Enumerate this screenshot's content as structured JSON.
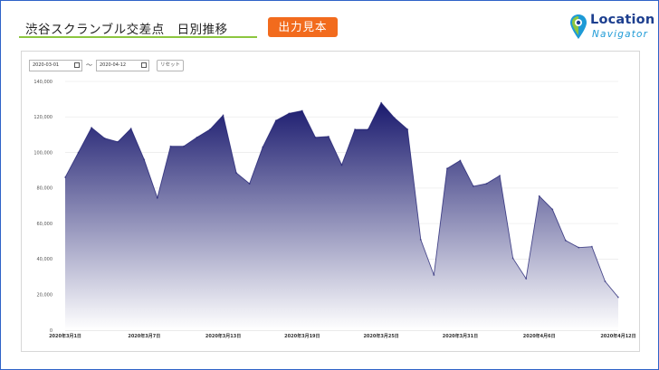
{
  "header": {
    "title": "渋谷スクランブル交差点　日別推移",
    "badge": "出力見本",
    "logo_line1": "Location",
    "logo_line2": "Navigator"
  },
  "controls": {
    "start_date": "2020-03-01",
    "separator": "〜",
    "end_date": "2020-04-12",
    "reset_label": "リセット"
  },
  "colors": {
    "area_top": "#1a1a6e",
    "area_bottom": "#ffffff",
    "line": "#1a1a6e",
    "accent_orange": "#f26b1d",
    "accent_green": "#8cc63f",
    "logo_blue": "#1d3f8f",
    "logo_light_blue": "#1d9ad6"
  },
  "chart_data": {
    "type": "area",
    "title": "",
    "xlabel": "",
    "ylabel": "",
    "ylim": [
      0,
      140000
    ],
    "y_ticks": [
      "0",
      "20,000",
      "40,000",
      "60,000",
      "80,000",
      "100,000",
      "120,000",
      "140,000"
    ],
    "x_tick_labels": [
      {
        "index": 0,
        "label": "2020年3月1日"
      },
      {
        "index": 6,
        "label": "2020年3月7日"
      },
      {
        "index": 12,
        "label": "2020年3月13日"
      },
      {
        "index": 18,
        "label": "2020年3月19日"
      },
      {
        "index": 24,
        "label": "2020年3月25日"
      },
      {
        "index": 30,
        "label": "2020年3月31日"
      },
      {
        "index": 36,
        "label": "2020年4月6日"
      },
      {
        "index": 42,
        "label": "2020年4月12日"
      }
    ],
    "grid": true,
    "values": [
      86000,
      100000,
      114000,
      108000,
      106000,
      113500,
      96000,
      74500,
      103500,
      103500,
      108500,
      113000,
      121000,
      88500,
      82500,
      103000,
      118000,
      122000,
      123500,
      108500,
      109000,
      93000,
      113000,
      113000,
      128000,
      119500,
      113000,
      51000,
      31000,
      91000,
      95500,
      81000,
      82500,
      87000,
      40500,
      29000,
      75500,
      68000,
      50500,
      46500,
      47000,
      27500,
      18500
    ]
  }
}
